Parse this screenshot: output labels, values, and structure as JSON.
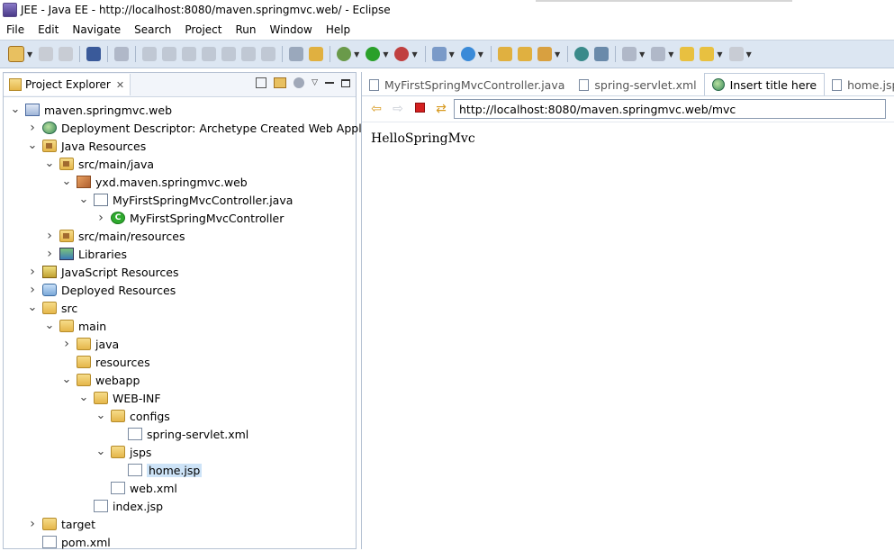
{
  "window": {
    "title": "JEE - Java EE - http://localhost:8080/maven.springmvc.web/ - Eclipse"
  },
  "menu": [
    "File",
    "Edit",
    "Navigate",
    "Search",
    "Project",
    "Run",
    "Window",
    "Help"
  ],
  "project_explorer": {
    "tab_label": "Project Explorer",
    "tree": [
      {
        "label": "maven.springmvc.web",
        "depth": 0,
        "expanded": true,
        "icon": "project-icon"
      },
      {
        "label": "Deployment Descriptor: Archetype Created Web Application",
        "depth": 1,
        "expanded": false,
        "icon": "deployment-descriptor-icon"
      },
      {
        "label": "Java Resources",
        "depth": 1,
        "expanded": true,
        "icon": "java-resources-icon"
      },
      {
        "label": "src/main/java",
        "depth": 2,
        "expanded": true,
        "icon": "source-folder-icon"
      },
      {
        "label": "yxd.maven.springmvc.web",
        "depth": 3,
        "expanded": true,
        "icon": "package-icon"
      },
      {
        "label": "MyFirstSpringMvcController.java",
        "depth": 4,
        "expanded": true,
        "icon": "java-file-icon"
      },
      {
        "label": "MyFirstSpringMvcController",
        "depth": 5,
        "expanded": false,
        "icon": "class-icon"
      },
      {
        "label": "src/main/resources",
        "depth": 2,
        "expanded": false,
        "icon": "source-folder-icon"
      },
      {
        "label": "Libraries",
        "depth": 2,
        "expanded": false,
        "icon": "libraries-icon"
      },
      {
        "label": "JavaScript Resources",
        "depth": 1,
        "expanded": false,
        "icon": "javascript-resources-icon"
      },
      {
        "label": "Deployed Resources",
        "depth": 1,
        "expanded": false,
        "icon": "deployed-resources-icon"
      },
      {
        "label": "src",
        "depth": 1,
        "expanded": true,
        "icon": "folder-icon"
      },
      {
        "label": "main",
        "depth": 2,
        "expanded": true,
        "icon": "folder-icon"
      },
      {
        "label": "java",
        "depth": 3,
        "expanded": false,
        "icon": "folder-icon"
      },
      {
        "label": "resources",
        "depth": 3,
        "leaf": true,
        "icon": "folder-icon"
      },
      {
        "label": "webapp",
        "depth": 3,
        "expanded": true,
        "icon": "folder-icon"
      },
      {
        "label": "WEB-INF",
        "depth": 4,
        "expanded": true,
        "icon": "folder-icon"
      },
      {
        "label": "configs",
        "depth": 5,
        "expanded": true,
        "icon": "folder-icon"
      },
      {
        "label": "spring-servlet.xml",
        "depth": 6,
        "leaf": true,
        "icon": "xml-file-icon"
      },
      {
        "label": "jsps",
        "depth": 5,
        "expanded": true,
        "icon": "folder-icon"
      },
      {
        "label": "home.jsp",
        "depth": 6,
        "leaf": true,
        "icon": "jsp-file-icon",
        "selected": true
      },
      {
        "label": "web.xml",
        "depth": 5,
        "leaf": true,
        "icon": "xml-file-icon"
      },
      {
        "label": "index.jsp",
        "depth": 4,
        "leaf": true,
        "icon": "jsp-file-icon"
      },
      {
        "label": "target",
        "depth": 1,
        "expanded": false,
        "icon": "folder-icon"
      },
      {
        "label": "pom.xml",
        "depth": 1,
        "leaf": true,
        "icon": "xml-file-icon"
      }
    ]
  },
  "editor": {
    "tabs": [
      {
        "label": "MyFirstSpringMvcController.java",
        "icon": "java-file-icon",
        "active": false
      },
      {
        "label": "spring-servlet.xml",
        "icon": "xml-file-icon",
        "active": false
      },
      {
        "label": "Insert title here",
        "icon": "globe-icon",
        "active": true
      },
      {
        "label": "home.jsp",
        "icon": "jsp-file-icon",
        "active": false
      }
    ],
    "url": "http://localhost:8080/maven.springmvc.web/mvc",
    "page_text": "HelloSpringMvc"
  }
}
